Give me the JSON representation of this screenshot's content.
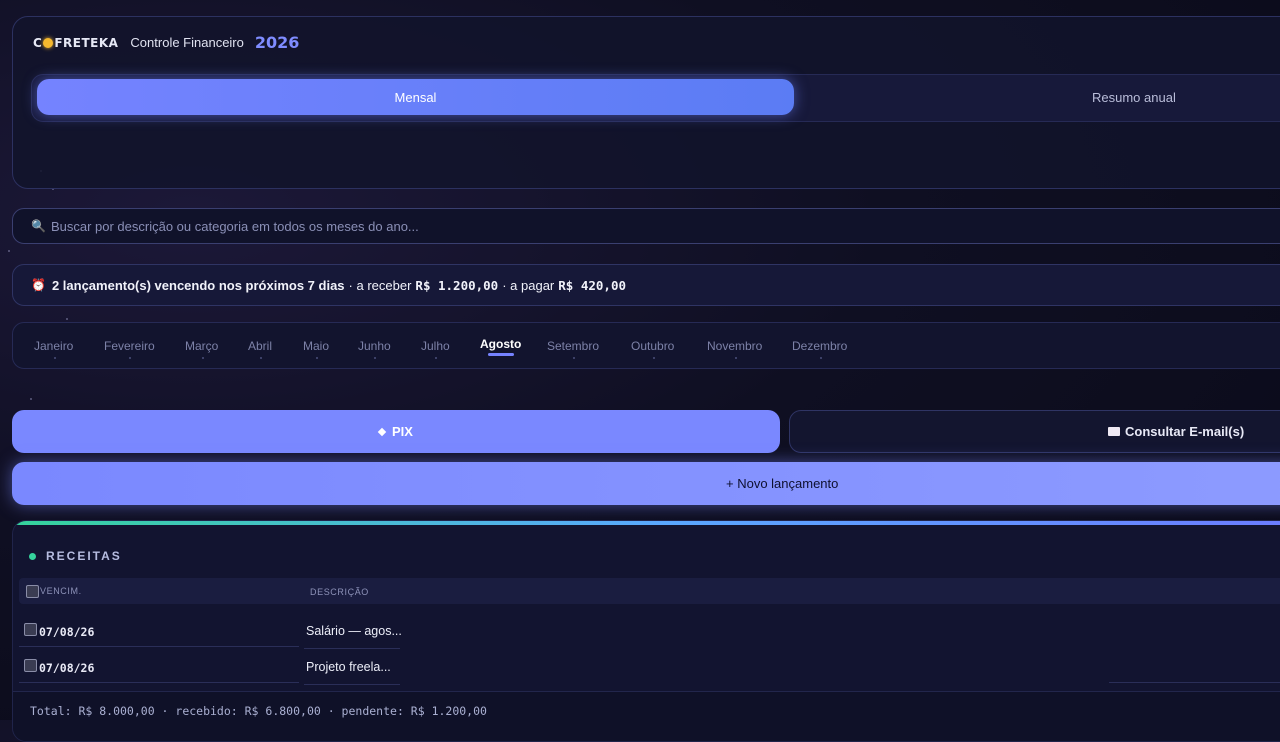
{
  "header": {
    "logo_pre": "C",
    "logo_post": "FRETEKA",
    "app_title": "Controle Financeiro",
    "year": "2026"
  },
  "tabs": {
    "monthly": "Mensal",
    "annual": "Resumo anual"
  },
  "search": {
    "placeholder": "Buscar por descrição ou categoria em todos os meses do ano..."
  },
  "alert": {
    "lead": "2 lançamento(s) vencendo nos próximos 7 dias",
    "receive_label": "· a receber",
    "receive_value": "R$ 1.200,00",
    "pay_label": "· a pagar",
    "pay_value": "R$ 420,00"
  },
  "months": [
    "Janeiro",
    "Fevereiro",
    "Março",
    "Abril",
    "Maio",
    "Junho",
    "Julho",
    "Agosto",
    "Setembro",
    "Outubro",
    "Novembro",
    "Dezembro"
  ],
  "active_month": "Agosto",
  "actions": {
    "pix": "PIX",
    "email": "Consultar E-mail(s)",
    "new_entry": "+ Novo lançamento"
  },
  "receitas": {
    "title": "RECEITAS",
    "columns": {
      "due": "VENCIM.",
      "description": "DESCRIÇÃO"
    },
    "rows": [
      {
        "date": "07/08/26",
        "description": "Salário — agos..."
      },
      {
        "date": "07/08/26",
        "description": "Projeto freela..."
      }
    ],
    "footer": "Total: R$ 8.000,00 · recebido: R$ 6.800,00 · pendente: R$ 1.200,00"
  },
  "colors": {
    "accent": "#7a88ff",
    "income": "#35d39c",
    "alarm": "#ff5d5d",
    "coin": "#f5b82e"
  }
}
